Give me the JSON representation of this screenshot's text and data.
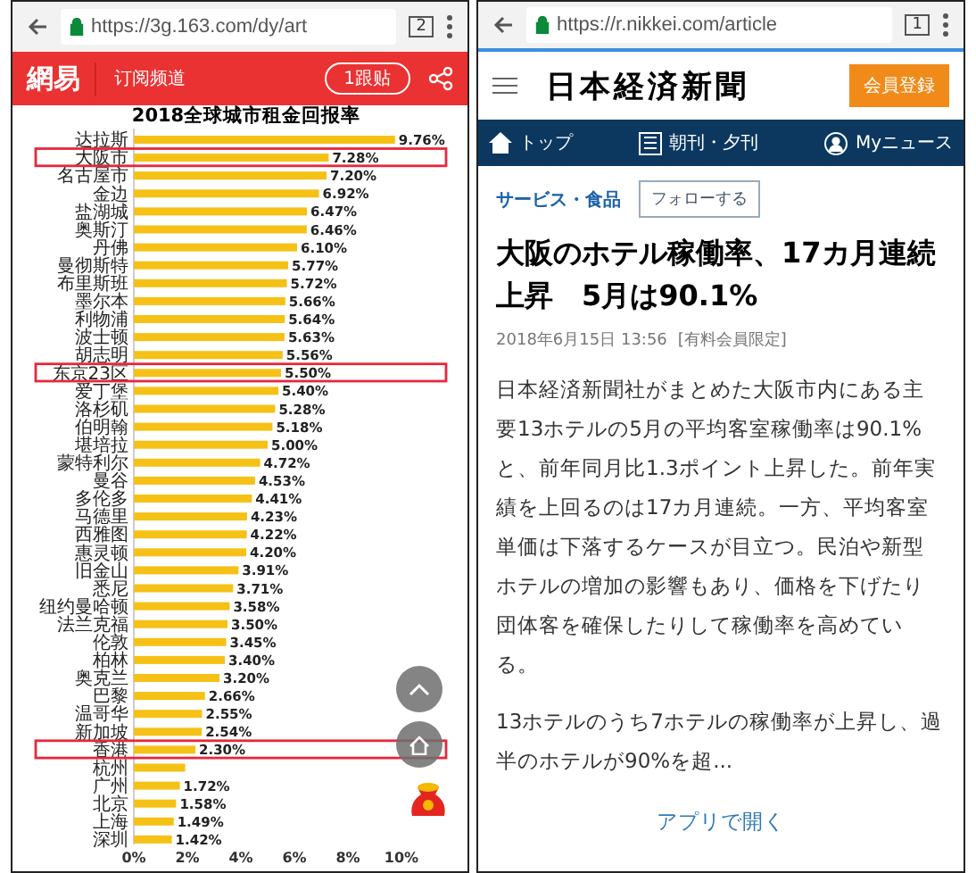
{
  "left_phone": {
    "browser": {
      "url": "https://3g.163.com/dy/art",
      "tab_count": "2"
    },
    "header": {
      "logo": "網易",
      "channel": "订阅频道",
      "comments_button": "1跟贴"
    },
    "chart_data": {
      "type": "bar",
      "orientation": "horizontal",
      "title": "2018全球城市租金回报率",
      "categories": [
        "达拉斯",
        "大阪市",
        "名古屋市",
        "金边",
        "盐湖城",
        "奥斯汀",
        "丹佛",
        "曼彻斯特",
        "布里斯班",
        "墨尔本",
        "利物浦",
        "波士顿",
        "胡志明",
        "东京23区",
        "爱丁堡",
        "洛杉矶",
        "伯明翰",
        "堪培拉",
        "蒙特利尔",
        "曼谷",
        "多伦多",
        "马德里",
        "西雅图",
        "惠灵顿",
        "旧金山",
        "悉尼",
        "纽约曼哈顿",
        "法兰克福",
        "伦敦",
        "柏林",
        "奥克兰",
        "巴黎",
        "温哥华",
        "新加坡",
        "香港",
        "杭州",
        "广州",
        "北京",
        "上海",
        "深圳"
      ],
      "series": [
        {
          "color": "#f5c116",
          "values": [
            9.76,
            7.28,
            7.2,
            6.92,
            6.47,
            6.46,
            6.1,
            5.77,
            5.72,
            5.66,
            5.64,
            5.63,
            5.56,
            5.5,
            5.4,
            5.28,
            5.18,
            5.0,
            4.72,
            4.53,
            4.41,
            4.23,
            4.22,
            4.2,
            3.91,
            3.71,
            3.58,
            3.5,
            3.45,
            3.4,
            3.2,
            2.66,
            2.55,
            2.54,
            2.3,
            1.92,
            1.72,
            1.58,
            1.49,
            1.42
          ]
        }
      ],
      "value_labels": [
        "9.76%",
        "7.28%",
        "7.20%",
        "6.92%",
        "6.47%",
        "6.46%",
        "6.10%",
        "5.77%",
        "5.72%",
        "5.66%",
        "5.64%",
        "5.63%",
        "5.56%",
        "5.50%",
        "5.40%",
        "5.28%",
        "5.18%",
        "5.00%",
        "4.72%",
        "4.53%",
        "4.41%",
        "4.23%",
        "4.22%",
        "4.20%",
        "3.91%",
        "3.71%",
        "3.58%",
        "3.50%",
        "3.45%",
        "3.40%",
        "3.20%",
        "2.66%",
        "2.55%",
        "2.54%",
        "2.30%",
        null,
        "1.72%",
        "1.58%",
        "1.49%",
        "1.42%"
      ],
      "xlim": [
        0,
        10
      ],
      "xticks": [
        {
          "value": 0,
          "label": "0%"
        },
        {
          "value": 2,
          "label": "2%"
        },
        {
          "value": 4,
          "label": "4%"
        },
        {
          "value": 6,
          "label": "6%"
        },
        {
          "value": 8,
          "label": "8%"
        },
        {
          "value": 10,
          "label": "10%"
        }
      ]
    },
    "row_highlights": [
      false,
      true,
      false,
      false,
      false,
      false,
      false,
      false,
      false,
      false,
      false,
      false,
      false,
      true,
      false,
      false,
      false,
      false,
      false,
      false,
      false,
      false,
      false,
      false,
      false,
      false,
      false,
      false,
      false,
      false,
      false,
      false,
      false,
      false,
      true,
      false,
      false,
      false,
      false,
      false
    ]
  },
  "right_phone": {
    "browser": {
      "url": "https://r.nikkei.com/article",
      "tab_count": "1"
    },
    "masthead": "日本経済新聞",
    "signup_button": "会員登録",
    "nav": [
      {
        "label": "トップ",
        "kind": "home"
      },
      {
        "label": "朝刊・夕刊",
        "kind": "paper"
      },
      {
        "label": "Myニュース",
        "kind": "user"
      }
    ],
    "category": "サービス・食品",
    "follow_button": "フォローする",
    "headline": "大阪のホテル稼働率、17カ月連続上昇　5月は90.1%",
    "date": "2018年6月15日 13:56",
    "badge": "[有料会員限定]",
    "paragraphs": [
      "日本経済新聞社がまとめた大阪市内にある主要13ホテルの5月の平均客室稼働率は90.1%と、前年同月比1.3ポイント上昇した。前年実績を上回るのは17カ月連続。一方、平均客室単価は下落するケースが目立つ。民泊や新型ホテルの増加の影響もあり、価格を下げたり団体客を確保したりして稼働率を高めている。",
      "13ホテルのうち7ホテルの稼働率が上昇し、過半のホテルが90%を超..."
    ],
    "open_in_app": "アプリで開く"
  }
}
